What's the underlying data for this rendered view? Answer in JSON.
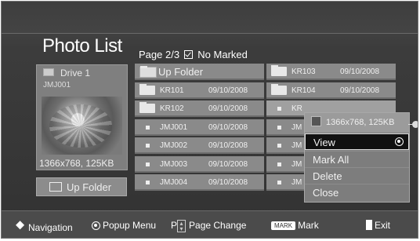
{
  "screen": {
    "title": "Photo List",
    "page_info": "Page 2/3",
    "marked_label": "No Marked"
  },
  "left_panel": {
    "drive_label": "Drive 1",
    "file_name": "JMJ001",
    "resolution": "1366x768, 125KB",
    "up_folder_label": "Up Folder"
  },
  "grid": {
    "col1": [
      {
        "name": "Up Folder",
        "date": "",
        "kind": "up"
      },
      {
        "name": "KR101",
        "date": "09/10/2008",
        "kind": "folder"
      },
      {
        "name": "KR102",
        "date": "09/10/2008",
        "kind": "folder"
      },
      {
        "name": "JMJ001",
        "date": "09/10/2008",
        "kind": "file"
      },
      {
        "name": "JMJ002",
        "date": "09/10/2008",
        "kind": "file"
      },
      {
        "name": "JMJ003",
        "date": "09/10/2008",
        "kind": "file"
      },
      {
        "name": "JMJ004",
        "date": "09/10/2008",
        "kind": "file"
      }
    ],
    "col2": [
      {
        "name": "KR103",
        "date": "09/10/2008",
        "kind": "folder"
      },
      {
        "name": "KR104",
        "date": "09/10/2008",
        "kind": "folder"
      },
      {
        "name": "KR",
        "date": "",
        "kind": "file"
      },
      {
        "name": "JM",
        "date": "",
        "kind": "file"
      },
      {
        "name": "JM",
        "date": "",
        "kind": "file"
      },
      {
        "name": "JM",
        "date": "",
        "kind": "file"
      },
      {
        "name": "JM",
        "date": "",
        "kind": "file"
      }
    ]
  },
  "popup": {
    "header": "1366x768, 125KB",
    "items": [
      "View",
      "Mark All",
      "Delete",
      "Close"
    ]
  },
  "footer": {
    "navigation": "Navigation",
    "popup_menu": "Popup Menu",
    "p_key": "P",
    "page_change": "Page Change",
    "mark_key": "MARK",
    "mark": "Mark",
    "exit": "Exit"
  }
}
